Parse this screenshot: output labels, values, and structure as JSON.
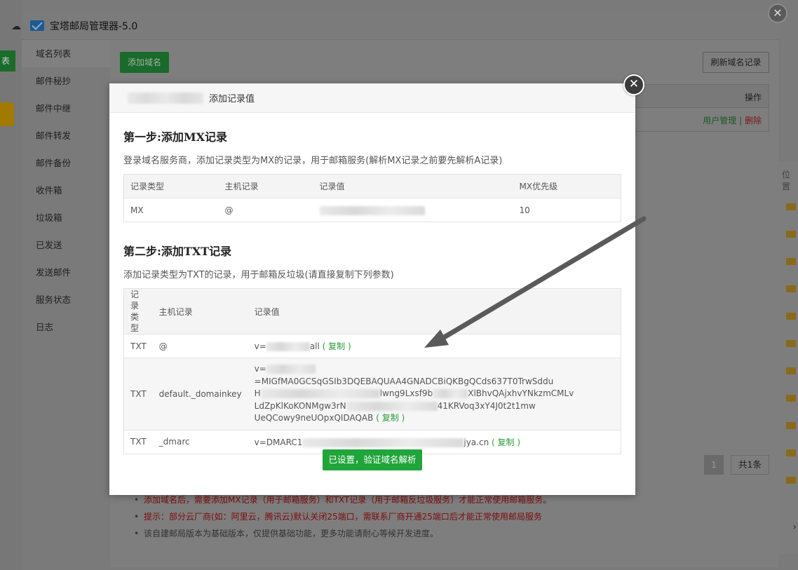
{
  "background": {
    "left_btn_label": "表",
    "right_col_header": "位置"
  },
  "manager": {
    "title": "宝塔邮局管理器-5.0",
    "sidebar": [
      {
        "label": "域名列表"
      },
      {
        "label": "邮件秘抄"
      },
      {
        "label": "邮件中继"
      },
      {
        "label": "邮件转发"
      },
      {
        "label": "邮件备份"
      },
      {
        "label": "收件箱"
      },
      {
        "label": "垃圾箱"
      },
      {
        "label": "已发送"
      },
      {
        "label": "发送邮件"
      },
      {
        "label": "服务状态"
      },
      {
        "label": "日志"
      }
    ],
    "add_domain_label": "添加域名",
    "refresh_label": "刷新域名记录",
    "table_header_ops": "操作",
    "row_user_mgmt": "用户管理",
    "row_sep": "|",
    "row_delete": "删除",
    "pager": {
      "current": "1",
      "total": "共1条"
    },
    "notes": [
      {
        "text": "添加域名后，需要添加MX记录（用于邮箱服务）和TXT记录（用于邮箱反垃圾服务）才能正常使用邮箱服务。",
        "color": "red"
      },
      {
        "text": "提示：部分云厂商(如：阿里云，腾讯云)默认关闭25端口，需联系厂商开通25端口后才能正常使用邮局服务",
        "color": "red"
      },
      {
        "text": "该自建邮局版本为基础版本，仅提供基础功能，更多功能请耐心等候开发进度。",
        "color": "gray"
      }
    ],
    "close_symbol": "✕"
  },
  "modal": {
    "title": "添加记录值",
    "close_symbol": "✕",
    "step1": {
      "heading": "第一步:添加MX记录",
      "desc": "登录域名服务商，添加记录类型为MX的记录，用于邮箱服务(解析MX记录之前要先解析A记录)",
      "headers": [
        "记录类型",
        "主机记录",
        "记录值",
        "MX优先级"
      ],
      "row": {
        "type": "MX",
        "host": "@",
        "priority": "10"
      }
    },
    "step2": {
      "heading": "第二步:添加TXT记录",
      "desc": "添加记录类型为TXT的记录，用于邮箱反垃圾(请直接复制下列参数)",
      "headers": [
        "记录类型",
        "主机记录",
        "记录值"
      ],
      "rows": [
        {
          "type": "TXT",
          "host": "@",
          "value_prefix": "v=",
          "value_suffix": "all",
          "copy": "( 复制 )"
        },
        {
          "type": "TXT",
          "host": "default._domainkey",
          "line1_prefix": "v=",
          "line1_suffix": "=MIGfMA0GCSqGSIb3DQEBAQUAA4GNADCBiQKBgQCds637T0TrwSddu",
          "line2_prefix": "H",
          "line2_mid": "lwng9Lxsf9b",
          "line2_suffix": "XlBhvQAjxhvYNkzmCMLv",
          "line3_prefix": "LdZpKlKoKONMgw3rN",
          "line3_suffix": "41KRVoq3xY4J0t2t1mw",
          "line4": "UeQCowy9neUOpxQIDAQAB",
          "copy": "( 复制 )"
        },
        {
          "type": "TXT",
          "host": "_dmarc",
          "value_prefix": "v=DMARC1",
          "value_suffix": "jya.cn",
          "copy": "( 复制 )"
        }
      ]
    },
    "verify_label": "已设置，验证域名解析"
  },
  "colors": {
    "accent_green": "#20a53a",
    "copy_green": "#2a9d3c",
    "delete_red": "#cc2222"
  }
}
